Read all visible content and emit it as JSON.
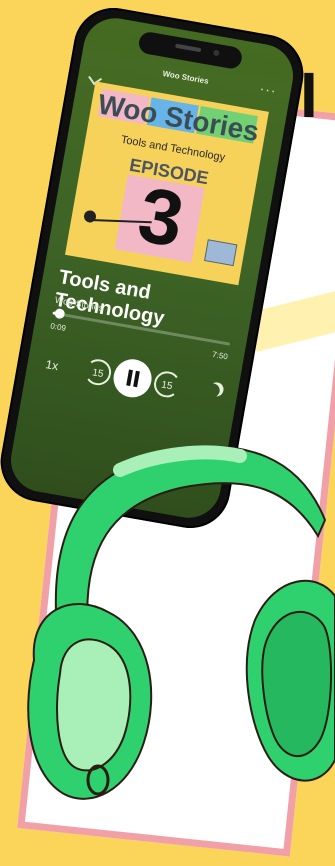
{
  "header": {
    "title": "Woo Stories",
    "more": "···"
  },
  "cover": {
    "title": "Woo Stories",
    "subtitle": "Tools and Technology",
    "episode_label": "EPISODE",
    "episode_number": "3"
  },
  "track": {
    "title": "Tools and Technology",
    "artist": "Woo Stories"
  },
  "player": {
    "elapsed": "0:09",
    "duration": "7:50",
    "progress": 0.04,
    "speed": "1x",
    "skip_back": "15",
    "skip_forward": "15"
  },
  "colors": {
    "accent": "#fbd45a",
    "phone_bg": "#456b22",
    "pink": "#f2a0a8",
    "headphone_green": "#2fd16f"
  }
}
